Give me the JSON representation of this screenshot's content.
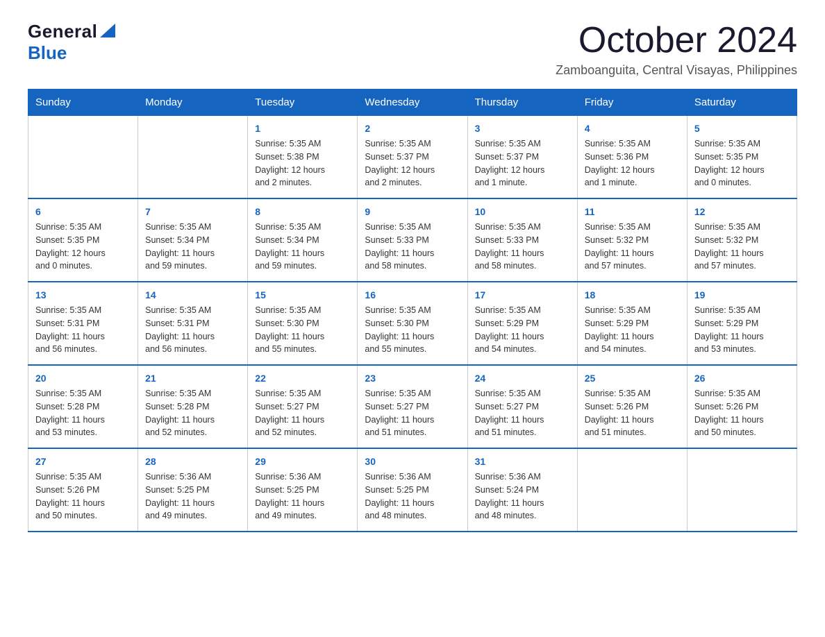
{
  "logo": {
    "general": "General",
    "blue": "Blue"
  },
  "title": "October 2024",
  "subtitle": "Zamboanguita, Central Visayas, Philippines",
  "headers": [
    "Sunday",
    "Monday",
    "Tuesday",
    "Wednesday",
    "Thursday",
    "Friday",
    "Saturday"
  ],
  "weeks": [
    [
      {
        "day": "",
        "info": ""
      },
      {
        "day": "",
        "info": ""
      },
      {
        "day": "1",
        "info": "Sunrise: 5:35 AM\nSunset: 5:38 PM\nDaylight: 12 hours\nand 2 minutes."
      },
      {
        "day": "2",
        "info": "Sunrise: 5:35 AM\nSunset: 5:37 PM\nDaylight: 12 hours\nand 2 minutes."
      },
      {
        "day": "3",
        "info": "Sunrise: 5:35 AM\nSunset: 5:37 PM\nDaylight: 12 hours\nand 1 minute."
      },
      {
        "day": "4",
        "info": "Sunrise: 5:35 AM\nSunset: 5:36 PM\nDaylight: 12 hours\nand 1 minute."
      },
      {
        "day": "5",
        "info": "Sunrise: 5:35 AM\nSunset: 5:35 PM\nDaylight: 12 hours\nand 0 minutes."
      }
    ],
    [
      {
        "day": "6",
        "info": "Sunrise: 5:35 AM\nSunset: 5:35 PM\nDaylight: 12 hours\nand 0 minutes."
      },
      {
        "day": "7",
        "info": "Sunrise: 5:35 AM\nSunset: 5:34 PM\nDaylight: 11 hours\nand 59 minutes."
      },
      {
        "day": "8",
        "info": "Sunrise: 5:35 AM\nSunset: 5:34 PM\nDaylight: 11 hours\nand 59 minutes."
      },
      {
        "day": "9",
        "info": "Sunrise: 5:35 AM\nSunset: 5:33 PM\nDaylight: 11 hours\nand 58 minutes."
      },
      {
        "day": "10",
        "info": "Sunrise: 5:35 AM\nSunset: 5:33 PM\nDaylight: 11 hours\nand 58 minutes."
      },
      {
        "day": "11",
        "info": "Sunrise: 5:35 AM\nSunset: 5:32 PM\nDaylight: 11 hours\nand 57 minutes."
      },
      {
        "day": "12",
        "info": "Sunrise: 5:35 AM\nSunset: 5:32 PM\nDaylight: 11 hours\nand 57 minutes."
      }
    ],
    [
      {
        "day": "13",
        "info": "Sunrise: 5:35 AM\nSunset: 5:31 PM\nDaylight: 11 hours\nand 56 minutes."
      },
      {
        "day": "14",
        "info": "Sunrise: 5:35 AM\nSunset: 5:31 PM\nDaylight: 11 hours\nand 56 minutes."
      },
      {
        "day": "15",
        "info": "Sunrise: 5:35 AM\nSunset: 5:30 PM\nDaylight: 11 hours\nand 55 minutes."
      },
      {
        "day": "16",
        "info": "Sunrise: 5:35 AM\nSunset: 5:30 PM\nDaylight: 11 hours\nand 55 minutes."
      },
      {
        "day": "17",
        "info": "Sunrise: 5:35 AM\nSunset: 5:29 PM\nDaylight: 11 hours\nand 54 minutes."
      },
      {
        "day": "18",
        "info": "Sunrise: 5:35 AM\nSunset: 5:29 PM\nDaylight: 11 hours\nand 54 minutes."
      },
      {
        "day": "19",
        "info": "Sunrise: 5:35 AM\nSunset: 5:29 PM\nDaylight: 11 hours\nand 53 minutes."
      }
    ],
    [
      {
        "day": "20",
        "info": "Sunrise: 5:35 AM\nSunset: 5:28 PM\nDaylight: 11 hours\nand 53 minutes."
      },
      {
        "day": "21",
        "info": "Sunrise: 5:35 AM\nSunset: 5:28 PM\nDaylight: 11 hours\nand 52 minutes."
      },
      {
        "day": "22",
        "info": "Sunrise: 5:35 AM\nSunset: 5:27 PM\nDaylight: 11 hours\nand 52 minutes."
      },
      {
        "day": "23",
        "info": "Sunrise: 5:35 AM\nSunset: 5:27 PM\nDaylight: 11 hours\nand 51 minutes."
      },
      {
        "day": "24",
        "info": "Sunrise: 5:35 AM\nSunset: 5:27 PM\nDaylight: 11 hours\nand 51 minutes."
      },
      {
        "day": "25",
        "info": "Sunrise: 5:35 AM\nSunset: 5:26 PM\nDaylight: 11 hours\nand 51 minutes."
      },
      {
        "day": "26",
        "info": "Sunrise: 5:35 AM\nSunset: 5:26 PM\nDaylight: 11 hours\nand 50 minutes."
      }
    ],
    [
      {
        "day": "27",
        "info": "Sunrise: 5:35 AM\nSunset: 5:26 PM\nDaylight: 11 hours\nand 50 minutes."
      },
      {
        "day": "28",
        "info": "Sunrise: 5:36 AM\nSunset: 5:25 PM\nDaylight: 11 hours\nand 49 minutes."
      },
      {
        "day": "29",
        "info": "Sunrise: 5:36 AM\nSunset: 5:25 PM\nDaylight: 11 hours\nand 49 minutes."
      },
      {
        "day": "30",
        "info": "Sunrise: 5:36 AM\nSunset: 5:25 PM\nDaylight: 11 hours\nand 48 minutes."
      },
      {
        "day": "31",
        "info": "Sunrise: 5:36 AM\nSunset: 5:24 PM\nDaylight: 11 hours\nand 48 minutes."
      },
      {
        "day": "",
        "info": ""
      },
      {
        "day": "",
        "info": ""
      }
    ]
  ]
}
